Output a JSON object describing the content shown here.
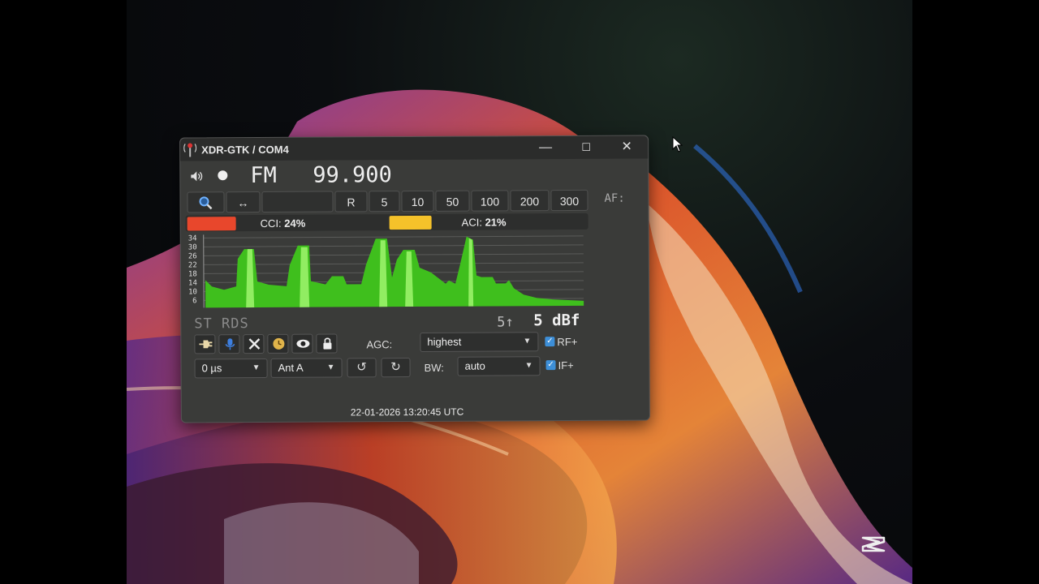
{
  "window": {
    "title": "XDR-GTK / COM4",
    "minimize": "—",
    "maximize": "☐",
    "close": "✕"
  },
  "tuner": {
    "band": "FM",
    "frequency": "99.900"
  },
  "step_buttons": {
    "r": "R",
    "s5": "5",
    "s10": "10",
    "s50": "50",
    "s100": "100",
    "s200": "200",
    "s300": "300"
  },
  "af_label": "AF:",
  "interference": {
    "cci_label": "CCI:",
    "cci_value": "24%",
    "aci_label": "ACI:",
    "aci_value": "21%",
    "cci_color": "#e8472c",
    "aci_color": "#f5c22a"
  },
  "spectrum": {
    "y_ticks": [
      "34",
      "30",
      "26",
      "22",
      "18",
      "14",
      "10",
      "6"
    ],
    "fill_color": "#3fbf1d",
    "peak_color": "#9af26a"
  },
  "status": {
    "stereo": "ST",
    "rds": "RDS",
    "signal_small": "5↑",
    "signal": "5 dBf"
  },
  "controls": {
    "agc_label": "AGC:",
    "agc_value": "highest",
    "bw_label": "BW:",
    "bw_value": "auto",
    "rf_label": "RF+",
    "if_label": "IF+",
    "deemphasis": "0 µs",
    "antenna": "Ant A"
  },
  "timestamp": "22-01-2026 13:20:45 UTC",
  "icons": [
    "speaker-icon",
    "record-dot-icon",
    "search-icon",
    "swap-arrows-icon",
    "connect-plug-icon",
    "microphone-icon",
    "tools-icon",
    "clock-icon",
    "eye-icon",
    "lock-icon",
    "rotate-ccw-icon",
    "rotate-cw-icon",
    "cursor-icon",
    "capcut-logo-icon"
  ]
}
